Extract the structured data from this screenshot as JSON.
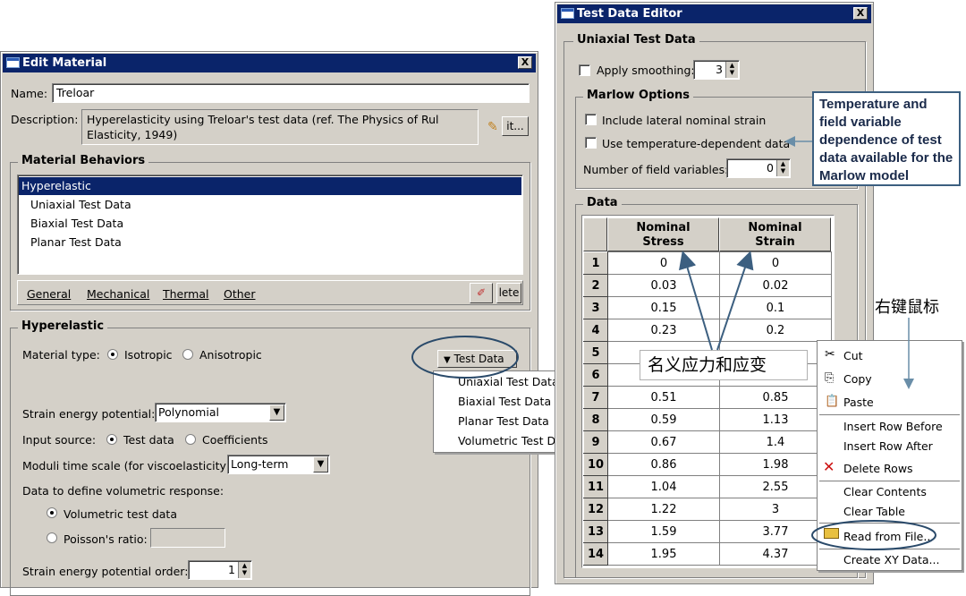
{
  "edit_material": {
    "title": "Edit Material",
    "close": "X",
    "name_label": "Name:",
    "name_value": "Treloar",
    "desc_label": "Description:",
    "desc_line1": "Hyperelasticity using Treloar's test data (ref. The Physics of Rul",
    "desc_line2": "Elasticity, 1949)",
    "edit_btn": "it...",
    "behaviors_title": "Material Behaviors",
    "behaviors": [
      "Hyperelastic",
      "Uniaxial Test Data",
      "Biaxial Test Data",
      "Planar Test Data"
    ],
    "menu_general": "General",
    "menu_mechanical": "Mechanical",
    "menu_thermal": "Thermal",
    "menu_other": "Other",
    "delete_btn": "lete",
    "hyper_title": "Hyperelastic",
    "material_type_label": "Material type:",
    "isotropic": "Isotropic",
    "anisotropic": "Anisotropic",
    "test_data_btn": "Test Data",
    "test_data_menu": [
      "Uniaxial Test Data",
      "Biaxial Test Data",
      "Planar Test Data",
      "Volumetric Test Data"
    ],
    "strain_energy_label": "Strain energy potential:",
    "strain_energy_value": "Polynomial",
    "input_source_label": "Input source:",
    "test_data_radio": "Test data",
    "coefficients_radio": "Coefficients",
    "moduli_label": "Moduli time scale (for viscoelasticity):",
    "moduli_value": "Long-term",
    "volumetric_label": "Data to define volumetric response:",
    "volumetric_radio": "Volumetric test data",
    "poisson_radio": "Poisson's ratio:",
    "order_label": "Strain energy potential order:",
    "order_value": "1"
  },
  "test_editor": {
    "title": "Test Data Editor",
    "close": "X",
    "uniaxial_title": "Uniaxial Test Data",
    "apply_smoothing": "Apply smoothing:",
    "smoothing_value": "3",
    "marlow_title": "Marlow Options",
    "include_lateral": "Include lateral nominal strain",
    "use_temp": "Use temperature-dependent data",
    "num_field_label": "Number of field variables:",
    "num_field_value": "0",
    "data_title": "Data",
    "col1_line1": "Nominal",
    "col1_line2": "Stress",
    "col2_line1": "Nominal",
    "col2_line2": "Strain"
  },
  "chart_data": {
    "type": "table",
    "columns": [
      "Nominal Stress",
      "Nominal Strain"
    ],
    "rows": [
      [
        "1",
        "0",
        "0"
      ],
      [
        "2",
        "0.03",
        "0.02"
      ],
      [
        "3",
        "0.15",
        "0.1"
      ],
      [
        "4",
        "0.23",
        "0.2"
      ],
      [
        "5",
        "",
        ""
      ],
      [
        "6",
        "",
        ""
      ],
      [
        "7",
        "0.51",
        "0.85"
      ],
      [
        "8",
        "0.59",
        "1.13"
      ],
      [
        "9",
        "0.67",
        "1.4"
      ],
      [
        "10",
        "0.86",
        "1.98"
      ],
      [
        "11",
        "1.04",
        "2.55"
      ],
      [
        "12",
        "1.22",
        "3"
      ],
      [
        "13",
        "1.59",
        "3.77"
      ],
      [
        "14",
        "1.95",
        "4.37"
      ]
    ]
  },
  "context_menu": {
    "cut": "Cut",
    "copy": "Copy",
    "paste": "Paste",
    "insert_before": "Insert Row Before",
    "insert_after": "Insert Row After",
    "delete_rows": "Delete Rows",
    "clear_contents": "Clear Contents",
    "clear_table": "Clear Table",
    "read_from_file": "Read from File...",
    "create_xy": "Create XY Data..."
  },
  "annotations": {
    "temperature_note": "Temperature and field variable dependence of test data available for the Marlow model",
    "nominal_callout": "名义应力和应变",
    "right_click": "右键鼠标"
  },
  "colors": {
    "titlebar": "#0a246a",
    "selection": "#0a246a",
    "window_bg": "#d4d0c8",
    "annotation_border": "#2f4f6f",
    "annotation_line": "#6a8ea8"
  }
}
